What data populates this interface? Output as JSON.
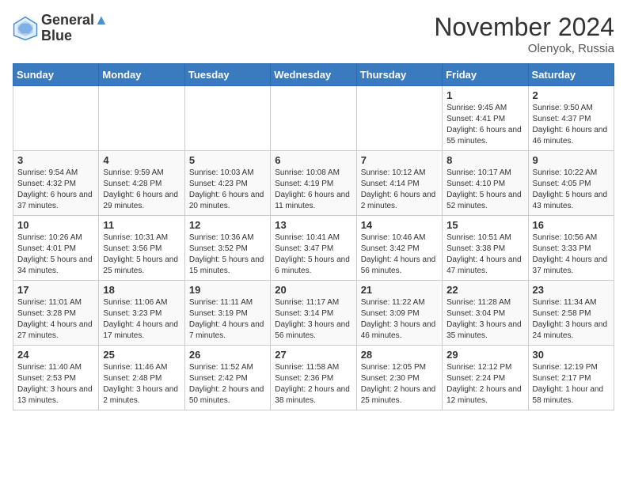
{
  "logo": {
    "line1": "General",
    "line2": "Blue"
  },
  "title": "November 2024",
  "subtitle": "Olenyok, Russia",
  "days_header": [
    "Sunday",
    "Monday",
    "Tuesday",
    "Wednesday",
    "Thursday",
    "Friday",
    "Saturday"
  ],
  "weeks": [
    [
      {
        "day": "",
        "info": ""
      },
      {
        "day": "",
        "info": ""
      },
      {
        "day": "",
        "info": ""
      },
      {
        "day": "",
        "info": ""
      },
      {
        "day": "",
        "info": ""
      },
      {
        "day": "1",
        "info": "Sunrise: 9:45 AM\nSunset: 4:41 PM\nDaylight: 6 hours and 55 minutes."
      },
      {
        "day": "2",
        "info": "Sunrise: 9:50 AM\nSunset: 4:37 PM\nDaylight: 6 hours and 46 minutes."
      }
    ],
    [
      {
        "day": "3",
        "info": "Sunrise: 9:54 AM\nSunset: 4:32 PM\nDaylight: 6 hours and 37 minutes."
      },
      {
        "day": "4",
        "info": "Sunrise: 9:59 AM\nSunset: 4:28 PM\nDaylight: 6 hours and 29 minutes."
      },
      {
        "day": "5",
        "info": "Sunrise: 10:03 AM\nSunset: 4:23 PM\nDaylight: 6 hours and 20 minutes."
      },
      {
        "day": "6",
        "info": "Sunrise: 10:08 AM\nSunset: 4:19 PM\nDaylight: 6 hours and 11 minutes."
      },
      {
        "day": "7",
        "info": "Sunrise: 10:12 AM\nSunset: 4:14 PM\nDaylight: 6 hours and 2 minutes."
      },
      {
        "day": "8",
        "info": "Sunrise: 10:17 AM\nSunset: 4:10 PM\nDaylight: 5 hours and 52 minutes."
      },
      {
        "day": "9",
        "info": "Sunrise: 10:22 AM\nSunset: 4:05 PM\nDaylight: 5 hours and 43 minutes."
      }
    ],
    [
      {
        "day": "10",
        "info": "Sunrise: 10:26 AM\nSunset: 4:01 PM\nDaylight: 5 hours and 34 minutes."
      },
      {
        "day": "11",
        "info": "Sunrise: 10:31 AM\nSunset: 3:56 PM\nDaylight: 5 hours and 25 minutes."
      },
      {
        "day": "12",
        "info": "Sunrise: 10:36 AM\nSunset: 3:52 PM\nDaylight: 5 hours and 15 minutes."
      },
      {
        "day": "13",
        "info": "Sunrise: 10:41 AM\nSunset: 3:47 PM\nDaylight: 5 hours and 6 minutes."
      },
      {
        "day": "14",
        "info": "Sunrise: 10:46 AM\nSunset: 3:42 PM\nDaylight: 4 hours and 56 minutes."
      },
      {
        "day": "15",
        "info": "Sunrise: 10:51 AM\nSunset: 3:38 PM\nDaylight: 4 hours and 47 minutes."
      },
      {
        "day": "16",
        "info": "Sunrise: 10:56 AM\nSunset: 3:33 PM\nDaylight: 4 hours and 37 minutes."
      }
    ],
    [
      {
        "day": "17",
        "info": "Sunrise: 11:01 AM\nSunset: 3:28 PM\nDaylight: 4 hours and 27 minutes."
      },
      {
        "day": "18",
        "info": "Sunrise: 11:06 AM\nSunset: 3:23 PM\nDaylight: 4 hours and 17 minutes."
      },
      {
        "day": "19",
        "info": "Sunrise: 11:11 AM\nSunset: 3:19 PM\nDaylight: 4 hours and 7 minutes."
      },
      {
        "day": "20",
        "info": "Sunrise: 11:17 AM\nSunset: 3:14 PM\nDaylight: 3 hours and 56 minutes."
      },
      {
        "day": "21",
        "info": "Sunrise: 11:22 AM\nSunset: 3:09 PM\nDaylight: 3 hours and 46 minutes."
      },
      {
        "day": "22",
        "info": "Sunrise: 11:28 AM\nSunset: 3:04 PM\nDaylight: 3 hours and 35 minutes."
      },
      {
        "day": "23",
        "info": "Sunrise: 11:34 AM\nSunset: 2:58 PM\nDaylight: 3 hours and 24 minutes."
      }
    ],
    [
      {
        "day": "24",
        "info": "Sunrise: 11:40 AM\nSunset: 2:53 PM\nDaylight: 3 hours and 13 minutes."
      },
      {
        "day": "25",
        "info": "Sunrise: 11:46 AM\nSunset: 2:48 PM\nDaylight: 3 hours and 2 minutes."
      },
      {
        "day": "26",
        "info": "Sunrise: 11:52 AM\nSunset: 2:42 PM\nDaylight: 2 hours and 50 minutes."
      },
      {
        "day": "27",
        "info": "Sunrise: 11:58 AM\nSunset: 2:36 PM\nDaylight: 2 hours and 38 minutes."
      },
      {
        "day": "28",
        "info": "Sunrise: 12:05 PM\nSunset: 2:30 PM\nDaylight: 2 hours and 25 minutes."
      },
      {
        "day": "29",
        "info": "Sunrise: 12:12 PM\nSunset: 2:24 PM\nDaylight: 2 hours and 12 minutes."
      },
      {
        "day": "30",
        "info": "Sunrise: 12:19 PM\nSunset: 2:17 PM\nDaylight: 1 hour and 58 minutes."
      }
    ]
  ]
}
